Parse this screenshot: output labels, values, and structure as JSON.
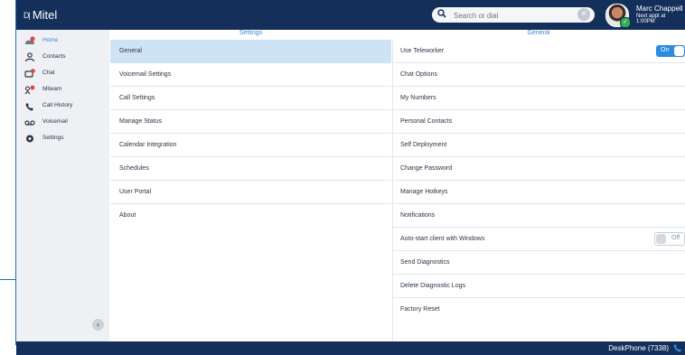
{
  "app": {
    "logo_text": "Mitel",
    "logo_mark": "D|"
  },
  "search": {
    "placeholder": "Search or dial",
    "clear_symbol": "×"
  },
  "user": {
    "name": "Marc Chappell",
    "status": "Next appt at 1:00PM"
  },
  "sidebar": {
    "items": [
      {
        "label": "Home",
        "icon": "home-icon"
      },
      {
        "label": "Contacts",
        "icon": "contacts-icon"
      },
      {
        "label": "Chat",
        "icon": "chat-icon"
      },
      {
        "label": "Miteam",
        "icon": "miteam-icon"
      },
      {
        "label": "Call History",
        "icon": "call-history-icon"
      },
      {
        "label": "Voicemail",
        "icon": "voicemail-icon"
      },
      {
        "label": "Settings",
        "icon": "gear-icon"
      }
    ],
    "collapse_symbol": "‹"
  },
  "settings_panel": {
    "header": "Settings",
    "items": [
      "General",
      "Voicemail Settings",
      "Call Settings",
      "Manage Status",
      "Calendar Integration",
      "Schedules",
      "User Portal",
      "About"
    ],
    "selected": "General"
  },
  "general_panel": {
    "header": "General",
    "items": [
      {
        "label": "Use Teleworker",
        "toggle": "On"
      },
      {
        "label": "Chat Options"
      },
      {
        "label": "My Numbers"
      },
      {
        "label": "Personal Contacts"
      },
      {
        "label": "Self Deployment"
      },
      {
        "label": "Change Password"
      },
      {
        "label": "Manage Hotkeys"
      },
      {
        "label": "Notifications"
      },
      {
        "label": "Auto-start client with Windows",
        "toggle": "Off"
      },
      {
        "label": "Send Diagnostics"
      },
      {
        "label": "Delete Diagnostic Logs"
      },
      {
        "label": "Factory Reset"
      }
    ]
  },
  "footer": {
    "device": "DeskPhone (7338)"
  },
  "colors": {
    "topbar": "#14305a",
    "accent": "#2c8be0",
    "selected_row": "#cfe3f7",
    "notification": "#e0453a"
  }
}
